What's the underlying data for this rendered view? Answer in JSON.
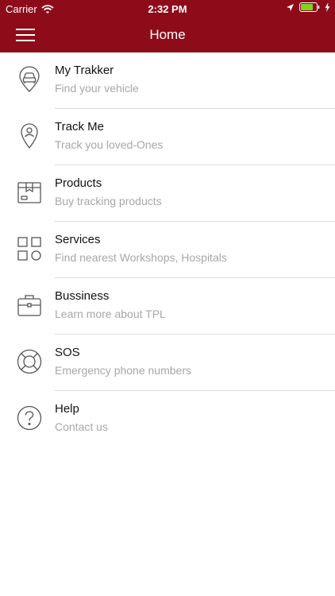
{
  "status_bar": {
    "carrier": "Carrier",
    "time": "2:32 PM"
  },
  "header": {
    "title": "Home",
    "background": "#8e0c1a"
  },
  "menu": {
    "items": [
      {
        "label": "My Trakker",
        "subtitle": "Find your vehicle",
        "icon": "car-pin-icon"
      },
      {
        "label": "Track Me",
        "subtitle": "Track you loved-Ones",
        "icon": "location-person-icon"
      },
      {
        "label": "Products",
        "subtitle": "Buy tracking products",
        "icon": "box-icon"
      },
      {
        "label": "Services",
        "subtitle": "Find nearest Workshops, Hospitals",
        "icon": "grid-shapes-icon"
      },
      {
        "label": "Bussiness",
        "subtitle": "Learn more about TPL",
        "icon": "briefcase-icon"
      },
      {
        "label": "SOS",
        "subtitle": "Emergency phone numbers",
        "icon": "lifebuoy-icon"
      },
      {
        "label": "Help",
        "subtitle": "Contact us",
        "icon": "question-icon"
      }
    ]
  }
}
